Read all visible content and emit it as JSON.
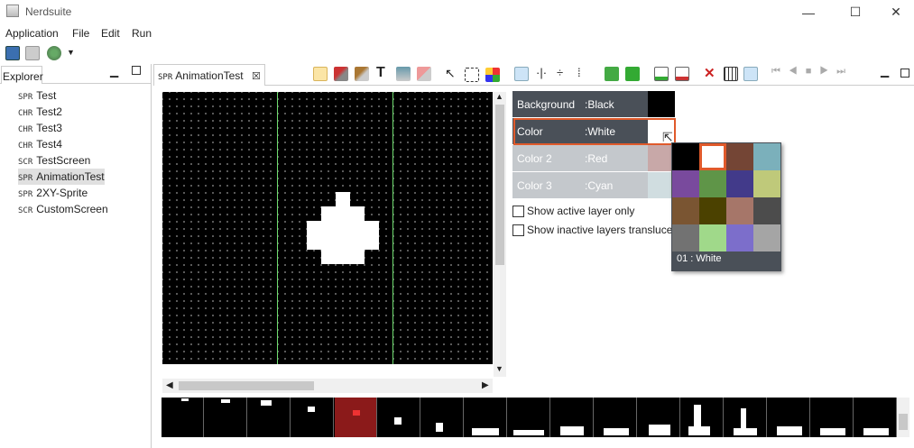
{
  "window": {
    "title": "Nerdsuite",
    "minimize": "—",
    "maximize": "☐",
    "close": "✕"
  },
  "menu": [
    "Application",
    "File",
    "Edit",
    "Run"
  ],
  "explorer": {
    "title": "Explorer",
    "items": [
      {
        "kind": "SPR",
        "name": "Test"
      },
      {
        "kind": "CHR",
        "name": "Test2"
      },
      {
        "kind": "CHR",
        "name": "Test3"
      },
      {
        "kind": "CHR",
        "name": "Test4"
      },
      {
        "kind": "SCR",
        "name": "TestScreen"
      },
      {
        "kind": "SPR",
        "name": "AnimationTest",
        "selected": true
      },
      {
        "kind": "SPR",
        "name": "2XY-Sprite"
      },
      {
        "kind": "SCR",
        "name": "CustomScreen"
      }
    ]
  },
  "editor": {
    "tab_kind": "SPR",
    "tab_name": "AnimationTest",
    "tab_close": "☒"
  },
  "colors": [
    {
      "label": "Background",
      "value": ":Black",
      "swatch": "#000000"
    },
    {
      "label": "Color",
      "value": ":White",
      "swatch": "#ffffff",
      "active": true
    },
    {
      "label": "Color 2",
      "value": ":Red",
      "swatch": "#c8a8a8"
    },
    {
      "label": "Color 3",
      "value": ":Cyan",
      "swatch": "#d0dde0"
    }
  ],
  "checks": {
    "active_only": "Show active layer only",
    "inactive_translucent": "Show inactive layers translucent"
  },
  "palette": {
    "selected_label": "01 : White",
    "colors": [
      "#000000",
      "#ffffff",
      "#744535",
      "#7bb0bb",
      "#794a9d",
      "#5f9548",
      "#423a8a",
      "#bfc97a",
      "#7a5532",
      "#4b4100",
      "#a67669",
      "#4c4c4c",
      "#727272",
      "#a0d98a",
      "#7c6ecb",
      "#a5a5a5"
    ]
  },
  "accent": "#e05a2b"
}
